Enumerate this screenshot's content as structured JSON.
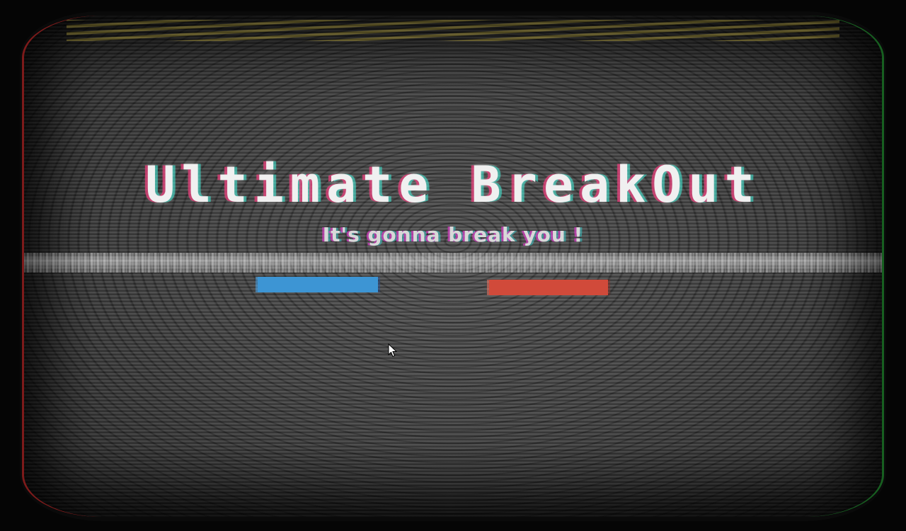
{
  "game": {
    "title": "Ultimate BreakOut",
    "subtitle": "It's gonna break you !",
    "menu": {
      "play_button_color": "#3d95d4",
      "quit_button_color": "#d14a3a"
    }
  },
  "effects": {
    "screen_style": "crt",
    "accent_stripe_color": "#c8b446",
    "chromatic_left": "#e63c78",
    "chromatic_right": "#3cdcc8"
  },
  "cursor": {
    "icon": "arrow-cursor-icon"
  }
}
